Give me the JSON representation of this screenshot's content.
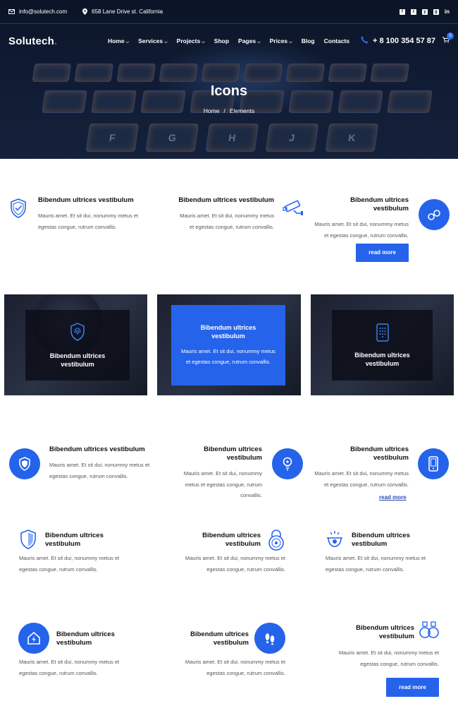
{
  "topbar": {
    "email": "info@solutech.com",
    "address": "658 Lane Drive st. California",
    "social": [
      "f",
      "t",
      "y",
      "g",
      "in"
    ]
  },
  "nav": {
    "logo": "Solutech",
    "logo_dot": ".",
    "menu": [
      "Home",
      "Services",
      "Projects",
      "Shop",
      "Pages",
      "Prices",
      "Blog",
      "Contacts"
    ],
    "menu_has_caret": [
      true,
      true,
      true,
      false,
      true,
      true,
      false,
      false
    ],
    "phone": "+ 8 100 354 57 87",
    "cart_count": "0"
  },
  "hero": {
    "title": "Icons",
    "crumb_home": "Home",
    "crumb_sep": "/",
    "crumb_current": "Elements",
    "keys": [
      "F",
      "G",
      "H",
      "J",
      "K"
    ]
  },
  "feature_title": "Bibendum ultrices vestibulum",
  "feature_text_a": "Mauris amet. Et sit dui, nonummy metus et egestas congue, rutrum convallis.",
  "read_more": "read more",
  "colors": {
    "accent": "#2563eb",
    "dark": "#0b1426"
  }
}
